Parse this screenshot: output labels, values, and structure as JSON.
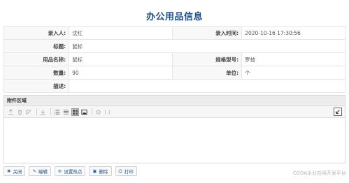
{
  "page": {
    "title": "办公用品信息"
  },
  "form": {
    "rows": [
      {
        "l1": "录入人:",
        "v1": "沈红",
        "l2": "录入时间:",
        "v2": "2020-10-16 17:30:56"
      },
      {
        "l1": "标题:",
        "v1": "鼠标"
      },
      {
        "l1": "用品名称:",
        "v1": "鼠标",
        "l2": "规格型号:",
        "v2": "罗技"
      },
      {
        "l1": "数量:",
        "v1": "90",
        "l2": "单位:",
        "v2": "个"
      },
      {
        "l1": "描述:",
        "v1": ""
      }
    ]
  },
  "attachments": {
    "title": "附件区域",
    "toolbar": [
      "upload-icon",
      "delete-icon",
      "edit-icon",
      "download-icon",
      "list-icon",
      "detail-list-icon",
      "grid-icon",
      "image-view-icon",
      "settings-icon",
      "tag-icon"
    ],
    "active_view": "grid-icon"
  },
  "actions": {
    "close": "关闭",
    "edit": "编辑",
    "hotspot": "设置热点",
    "delete": "删除",
    "print": "打印"
  },
  "watermark": "O2OA企业应用开发平台"
}
